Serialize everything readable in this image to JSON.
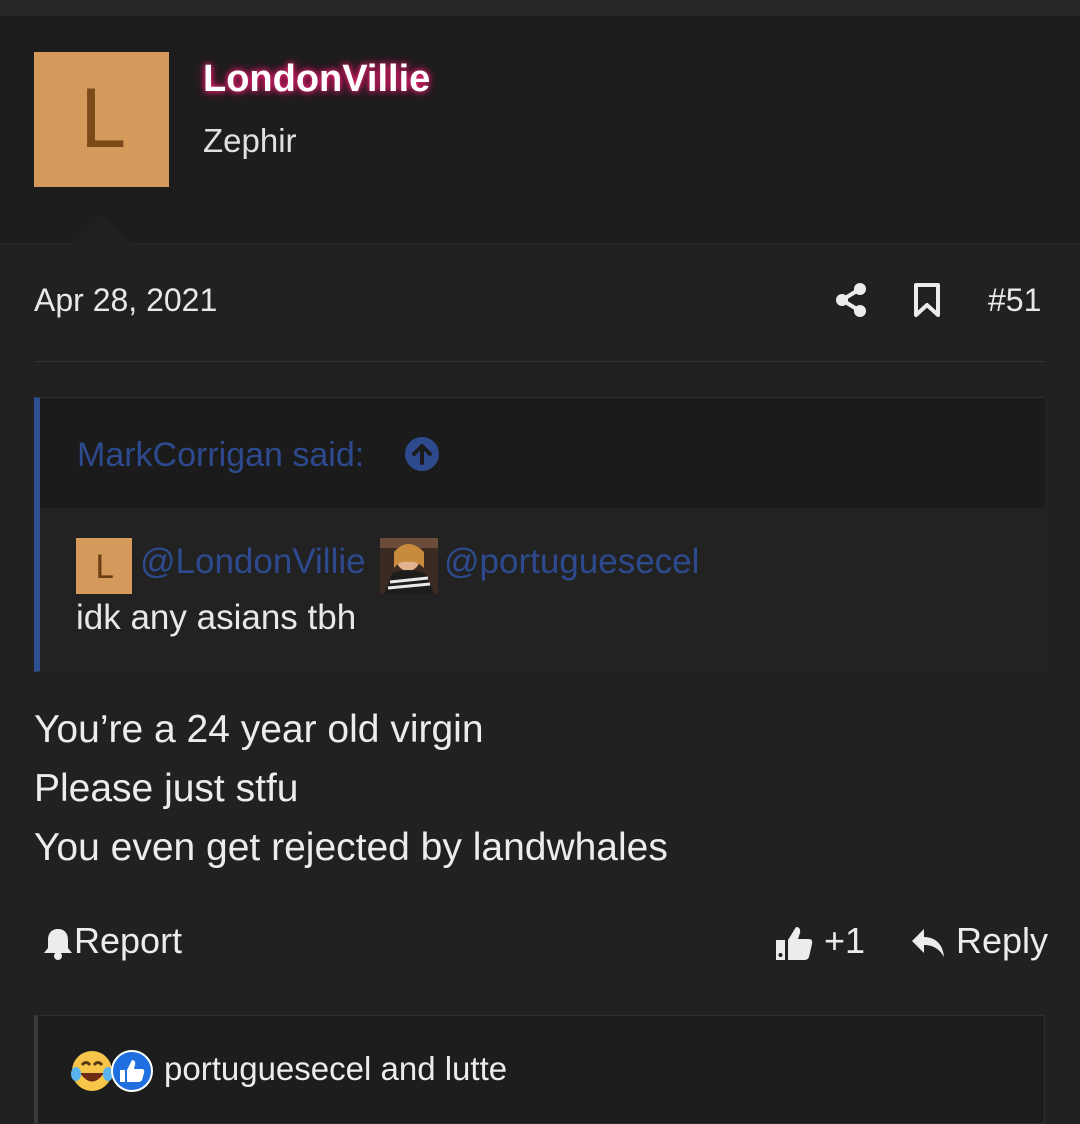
{
  "post": {
    "author": {
      "avatar_letter": "L",
      "username": "LondonVillie",
      "title": "Zephir"
    },
    "date": "Apr 28, 2021",
    "number": "#51",
    "quote": {
      "author_label": "MarkCorrigan said:",
      "mention_avatar_letter": "L",
      "mention_1": "@LondonVillie",
      "mention_2": "@portuguesecel",
      "text": "idk any asians tbh"
    },
    "message_lines": [
      "You’re a 24 year old virgin",
      "Please just stfu",
      "You even get rejected by landwhales"
    ],
    "actions": {
      "report": "Report",
      "like": "+1",
      "reply": "Reply"
    },
    "reactions": {
      "names": "portuguesecel and lutte",
      "icons": [
        "laughing-crying-emoji",
        "thumbs-up-emoji"
      ]
    }
  },
  "colors": {
    "background": "#212121",
    "avatar": "#d39a5c",
    "username_glow": "#ff2f7a",
    "quote_link": "#2e4a8e",
    "quote_border": "#2f4f93"
  }
}
